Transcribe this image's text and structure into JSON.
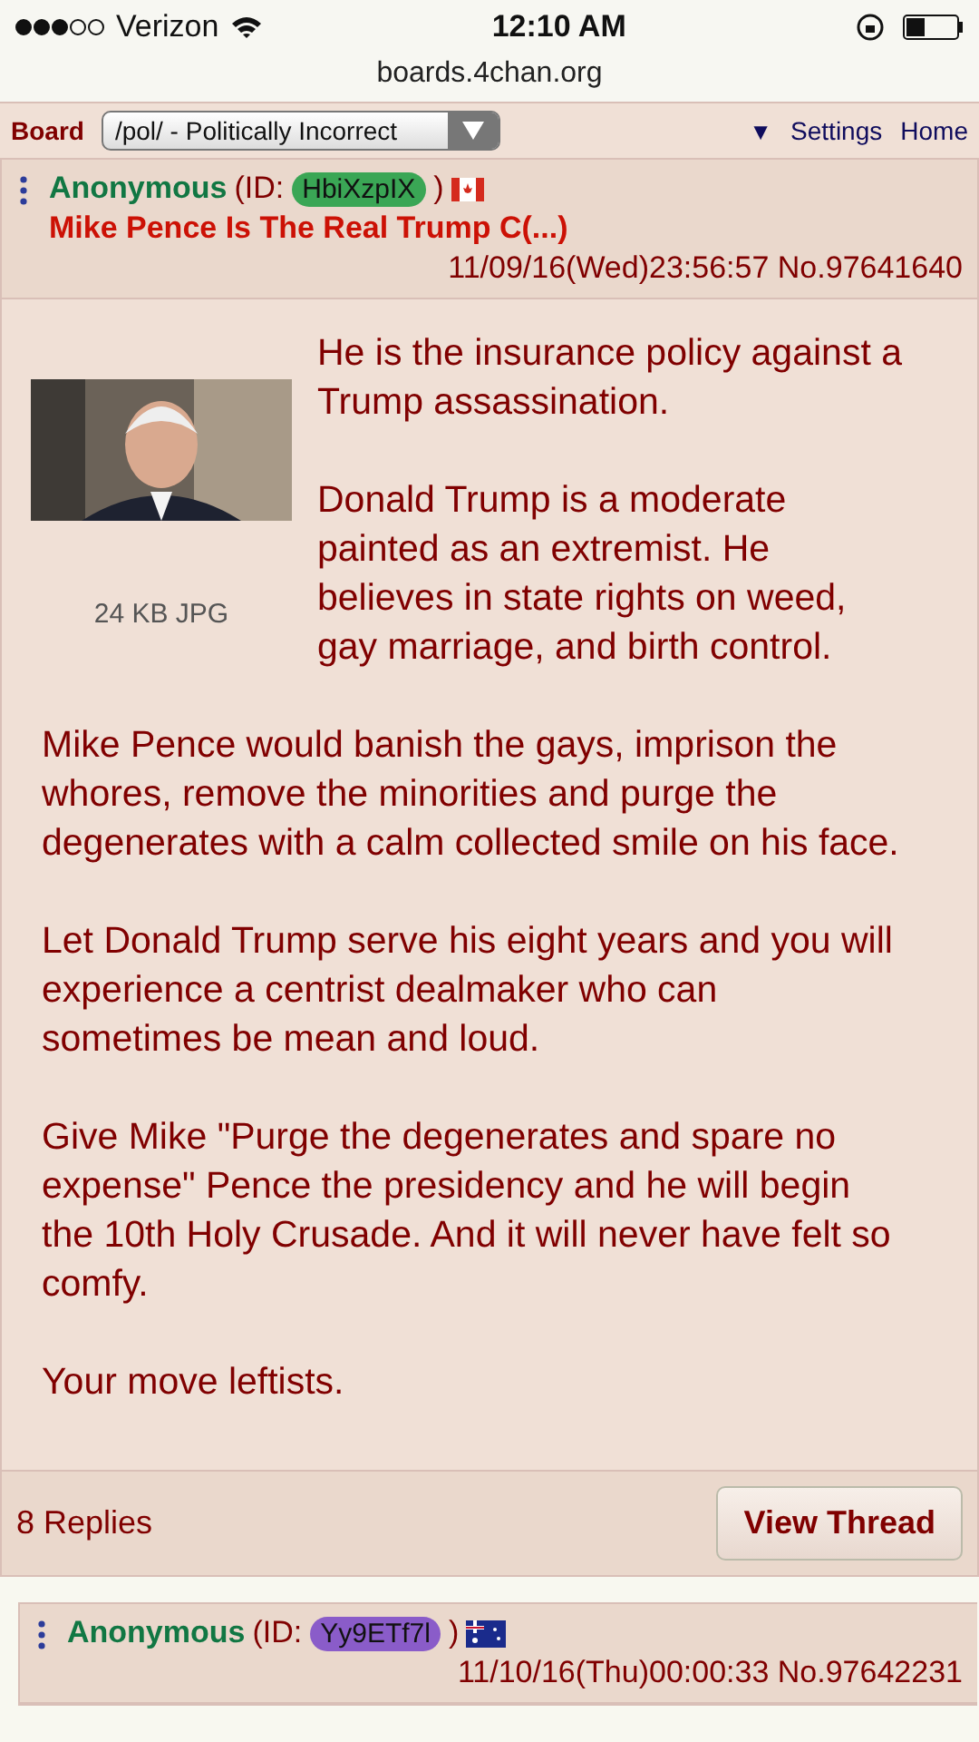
{
  "status_bar": {
    "carrier": "Verizon",
    "time": "12:10 AM"
  },
  "address_bar": {
    "url": "boards.4chan.org"
  },
  "nav": {
    "board_label": "Board",
    "board_select": "/pol/ - Politically Incorrect",
    "menu_arrow": "▼",
    "links": [
      "Settings",
      "Home"
    ]
  },
  "posts": [
    {
      "name": "Anonymous",
      "id_label": "(ID:",
      "id": "HbiXzpIX",
      "color": "#3aa655",
      "id_close": ")",
      "flag": {
        "kind": "canada"
      },
      "subject": "Mike Pence Is The Real Trump C(...)",
      "datetime": "11/09/16(Wed)23:56:57 No.97641640",
      "image": {
        "kind": "picture",
        "size": "24 KB JPG"
      },
      "side_paragraphs": [
        "He is the insurance policy against a Trump assassination.",
        "Donald Trump is a moderate painted as an extremist. He believes in state rights on weed, gay marriage, and birth control."
      ],
      "paragraphs": [
        "Mike Pence would banish the gays, imprison the whores, remove the minorities and purge the degenerates with a calm collected smile on his face.",
        "Let Donald Trump serve his eight years and you will experience a centrist dealmaker who can sometimes be mean and loud.",
        "Give Mike \"Purge the degenerates and spare no expense\" Pence the presidency and he will begin the 10th Holy Crusade. And it will never have felt so comfy.",
        "Your move leftists."
      ],
      "replies": "8 Replies",
      "button": "View Thread"
    },
    {
      "name": "Anonymous",
      "id_label": "(ID:",
      "id": "Yy9ETf7l",
      "color": "#8a5cc9",
      "id_close": ")",
      "flag": {
        "kind": "australia"
      },
      "datetime": "11/10/16(Thu)00:00:33 No.97642231"
    }
  ]
}
